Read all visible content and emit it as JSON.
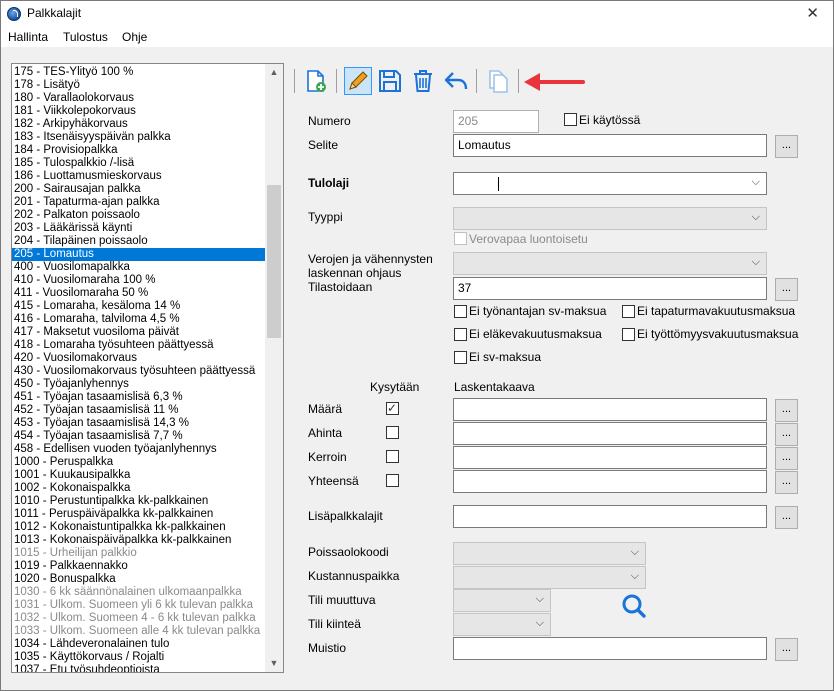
{
  "window": {
    "title": "Palkkalajit",
    "close_label": "✕"
  },
  "menu": [
    "Hallinta",
    "Tulostus",
    "Ohje"
  ],
  "list": {
    "items": [
      {
        "text": "175 - TES-Ylityö 100 %"
      },
      {
        "text": "178 - Lisätyö"
      },
      {
        "text": "180 - Varallaolokorvaus"
      },
      {
        "text": "181 - Viikkolepokorvaus"
      },
      {
        "text": "182 - Arkipyhäkorvaus"
      },
      {
        "text": "183 - Itsenäisyyspäivän palkka"
      },
      {
        "text": "184 - Provisiopalkka"
      },
      {
        "text": "185 - Tulospalkkio /-lisä"
      },
      {
        "text": "186 - Luottamusmieskorvaus"
      },
      {
        "text": "200 - Sairausajan palkka"
      },
      {
        "text": "201 - Tapaturma-ajan palkka"
      },
      {
        "text": "202 - Palkaton poissaolo"
      },
      {
        "text": "203 - Lääkärissä käynti"
      },
      {
        "text": "204 - Tilapäinen poissaolo"
      },
      {
        "text": "205 - Lomautus",
        "selected": true
      },
      {
        "text": "400 - Vuosilomapalkka"
      },
      {
        "text": "410 - Vuosilomaraha 100 %"
      },
      {
        "text": "411 - Vuosilomaraha 50 %"
      },
      {
        "text": "415 - Lomaraha, kesäloma 14 %"
      },
      {
        "text": "416 - Lomaraha, talviloma 4,5 %"
      },
      {
        "text": "417 - Maksetut vuosiloma päivät"
      },
      {
        "text": "418 - Lomaraha työsuhteen päättyessä"
      },
      {
        "text": "420 - Vuosilomakorvaus"
      },
      {
        "text": "430 - Vuosilomakorvaus työsuhteen päättyessä"
      },
      {
        "text": "450 - Työajanlyhennys"
      },
      {
        "text": "451 - Työajan tasaamislisä 6,3 %"
      },
      {
        "text": "452 - Työajan tasaamislisä 11 %"
      },
      {
        "text": "453 - Työajan tasaamislisä 14,3 %"
      },
      {
        "text": "454 - Työajan tasaamislisä 7,7 %"
      },
      {
        "text": "458 - Edellisen vuoden työajanlyhennys"
      },
      {
        "text": "1000 - Peruspalkka"
      },
      {
        "text": "1001 - Kuukausipalkka"
      },
      {
        "text": "1002 - Kokonaispalkka"
      },
      {
        "text": "1010 - Perustuntipalkka kk-palkkainen"
      },
      {
        "text": "1011 - Peruspäiväpalkka kk-palkkainen"
      },
      {
        "text": "1012 - Kokonaistuntipalkka kk-palkkainen"
      },
      {
        "text": "1013 - Kokonaispäiväpalkka kk-palkkainen"
      },
      {
        "text": "1015 - Urheilijan palkkio",
        "disabled": true
      },
      {
        "text": "1019 - Palkkaennakko"
      },
      {
        "text": "1020 - Bonuspalkka"
      },
      {
        "text": "1030 - 6 kk säännönalainen ulkomaanpalkka",
        "disabled": true
      },
      {
        "text": "1031 - Ulkom. Suomeen yli 6 kk tulevan palkka",
        "disabled": true
      },
      {
        "text": "1032 - Ulkom. Suomeen 4 - 6 kk tulevan palkka",
        "disabled": true
      },
      {
        "text": "1033 - Ulkom. Suomeen alle 4 kk tulevan palkka",
        "disabled": true
      },
      {
        "text": "1034 - Lähdeveronalainen tulo"
      },
      {
        "text": "1035 - Käyttökorvaus / Rojalti"
      },
      {
        "text": "1037 - Etu työsuhdeoptioista"
      }
    ]
  },
  "toolbar": {
    "buttons": [
      {
        "name": "new-record-button",
        "icon": "new-document-icon"
      },
      {
        "name": "edit-button",
        "icon": "pencil-icon",
        "active": true
      },
      {
        "name": "save-button",
        "icon": "floppy-disk-icon"
      },
      {
        "name": "delete-button",
        "icon": "trash-icon"
      },
      {
        "name": "undo-button",
        "icon": "undo-arrow-icon"
      },
      {
        "name": "copy-button",
        "icon": "copy-pages-icon",
        "disabled": true
      }
    ],
    "accent": "#1a73d9",
    "annotation_arrow_color": "#e8343a"
  },
  "form": {
    "numero_label": "Numero",
    "numero_value": "205",
    "ei_kaytossa_label": "Ei käytössä",
    "selite_label": "Selite",
    "selite_value": "Lomautus",
    "tulolaji_label": "Tulolaji",
    "tyyppi_label": "Tyyppi",
    "verovapaa_label": "Verovapaa luontoisetu",
    "verojen_label_1": "Verojen ja vähennysten",
    "verojen_label_2": "laskennan ohjaus",
    "tilastoidaan_label": "Tilastoidaan",
    "tilastoidaan_value": "37",
    "checks": {
      "tyonantaja_sv": "Ei työnantajan sv-maksua",
      "tapaturma": "Ei tapaturmavakuutusmaksua",
      "elake": "Ei eläkevakuutusmaksua",
      "tyottomyys": "Ei työttömyysvakuutusmaksua",
      "sv": "Ei sv-maksua"
    },
    "kysytaan_header": "Kysytään",
    "laskentakaava_header": "Laskentakaava",
    "formula_rows": [
      {
        "label": "Määrä",
        "checked": true
      },
      {
        "label": "Ahinta",
        "checked": false
      },
      {
        "label": "Kerroin",
        "checked": false
      },
      {
        "label": "Yhteensä",
        "checked": false
      }
    ],
    "lisapalkkalajit_label": "Lisäpalkkalajit",
    "poissaolokoodi_label": "Poissaolokoodi",
    "kustannuspaikka_label": "Kustannuspaikka",
    "tili_muuttuva_label": "Tili muuttuva",
    "tili_kiintea_label": "Tili kiinteä",
    "muistio_label": "Muistio",
    "dots_label": "..."
  }
}
